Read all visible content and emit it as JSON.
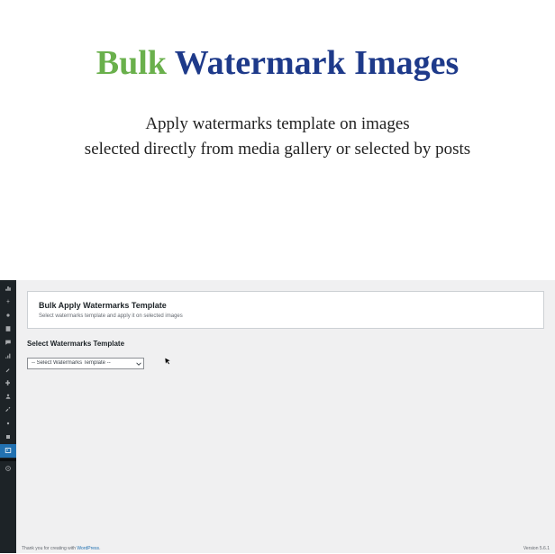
{
  "hero": {
    "title_1": "Bulk",
    "title_2": "Watermark Images",
    "sub_line1": "Apply watermarks template on images",
    "sub_line2": "selected directly from media gallery or selected by posts"
  },
  "admin": {
    "card_title": "Bulk Apply Watermarks Template",
    "card_desc": "Select watermarks template and apply it on selected images",
    "section_label": "Select Watermarks Template",
    "select_placeholder": "-- Select Watermarks Template --"
  },
  "footer": {
    "thanks_prefix": "Thank you for creating with ",
    "thanks_link": "WordPress",
    "thanks_suffix": ".",
    "version": "Version 5.6.1"
  }
}
